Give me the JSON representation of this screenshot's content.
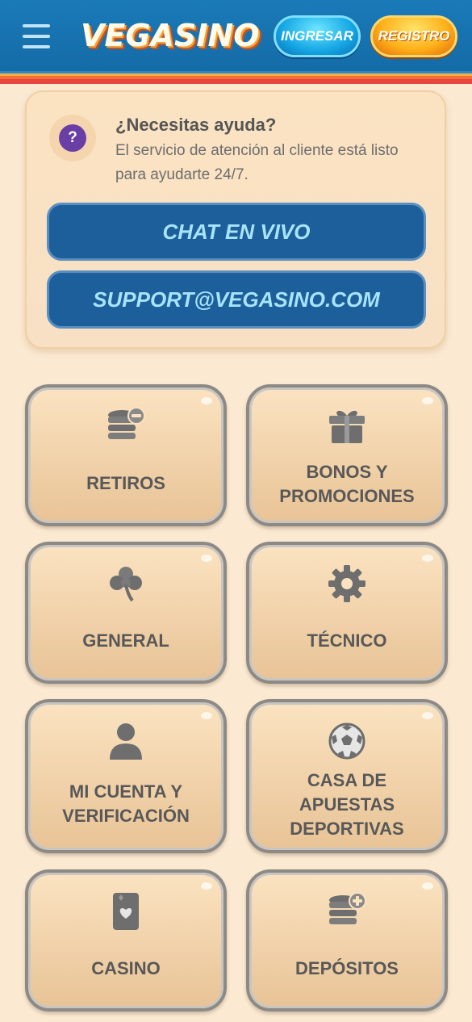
{
  "header": {
    "logo": "VEGASINO",
    "login_label": "INGRESAR",
    "register_label": "REGISTRO"
  },
  "help": {
    "title": "¿Necesitas ayuda?",
    "description": "El servicio de atención al cliente está listo para ayudarte 24/7.",
    "icon_glyph": "?",
    "chat_label": "CHAT EN VIVO",
    "email_label": "SUPPORT@VEGASINO.COM"
  },
  "categories": [
    {
      "label": "RETIROS",
      "icon": "coins-minus-icon"
    },
    {
      "label": "BONOS Y PROMOCIONES",
      "icon": "gift-icon"
    },
    {
      "label": "GENERAL",
      "icon": "clover-icon"
    },
    {
      "label": "TÉCNICO",
      "icon": "gear-icon"
    },
    {
      "label": "MI CUENTA Y VERIFICACIÓN",
      "icon": "user-icon"
    },
    {
      "label": "CASA DE APUESTAS DEPORTIVAS",
      "icon": "soccer-ball-icon"
    },
    {
      "label": "CASINO",
      "icon": "playing-card-icon"
    },
    {
      "label": "DEPÓSITOS",
      "icon": "coins-plus-icon"
    }
  ],
  "colors": {
    "background": "#fbe9d2",
    "header": "#1369a4",
    "support_button": "#1d5f9a",
    "help_icon": "#6a3fa5"
  }
}
